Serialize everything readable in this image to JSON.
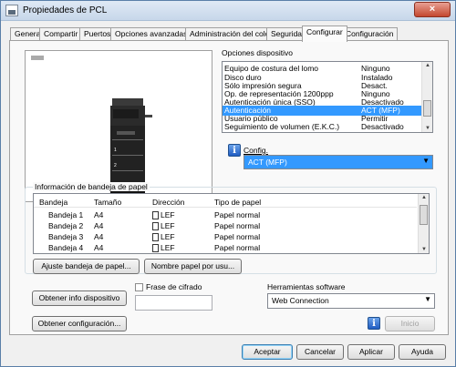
{
  "window": {
    "title": "Propiedades de PCL",
    "close_glyph": "×"
  },
  "tabs": [
    "General",
    "Compartir",
    "Puertos",
    "Opciones avanzadas",
    "Administración del color",
    "Seguridad",
    "Configurar",
    "Configuración"
  ],
  "active_tab": "Configurar",
  "device_options": {
    "label": "Opciones dispositivo",
    "rows": [
      {
        "name": "Equipo de costura del lomo",
        "value": "Ninguno"
      },
      {
        "name": "Disco duro",
        "value": "Instalado"
      },
      {
        "name": "Sólo impresión segura",
        "value": "Desact."
      },
      {
        "name": "Op. de representación 1200ppp",
        "value": "Ninguno"
      },
      {
        "name": "Autenticación única (SSO)",
        "value": "Desactivado"
      },
      {
        "name": "Autenticación",
        "value": "ACT (MFP)"
      },
      {
        "name": "Usuario público",
        "value": "Permitir"
      },
      {
        "name": "Seguimiento de volumen (E.K.C.)",
        "value": "Desactivado"
      }
    ],
    "selected_index": 5,
    "config_label": "Config.",
    "config_value": "ACT (MFP)"
  },
  "tray_info": {
    "label": "Información de bandeja de papel",
    "columns": [
      "Bandeja",
      "Tamaño",
      "Dirección",
      "Tipo de papel"
    ],
    "rows": [
      {
        "tray": "Bandeja 1",
        "size": "A4",
        "dir": "LEF",
        "type": "Papel normal"
      },
      {
        "tray": "Bandeja 2",
        "size": "A4",
        "dir": "LEF",
        "type": "Papel normal"
      },
      {
        "tray": "Bandeja 3",
        "size": "A4",
        "dir": "LEF",
        "type": "Papel normal"
      },
      {
        "tray": "Bandeja 4",
        "size": "A4",
        "dir": "LEF",
        "type": "Papel normal"
      }
    ]
  },
  "buttons": {
    "adjust_tray": "Ajuste bandeja de papel...",
    "paper_name": "Nombre papel por usu...",
    "get_device_info": "Obtener info dispositivo",
    "get_config": "Obtener configuración...",
    "start": "Inicio",
    "ok": "Aceptar",
    "cancel": "Cancelar",
    "apply": "Aplicar",
    "help": "Ayuda"
  },
  "passphrase": {
    "label": "Frase de cifrado",
    "value": ""
  },
  "software_tools": {
    "label": "Herramientas software",
    "value": "Web Connection"
  }
}
